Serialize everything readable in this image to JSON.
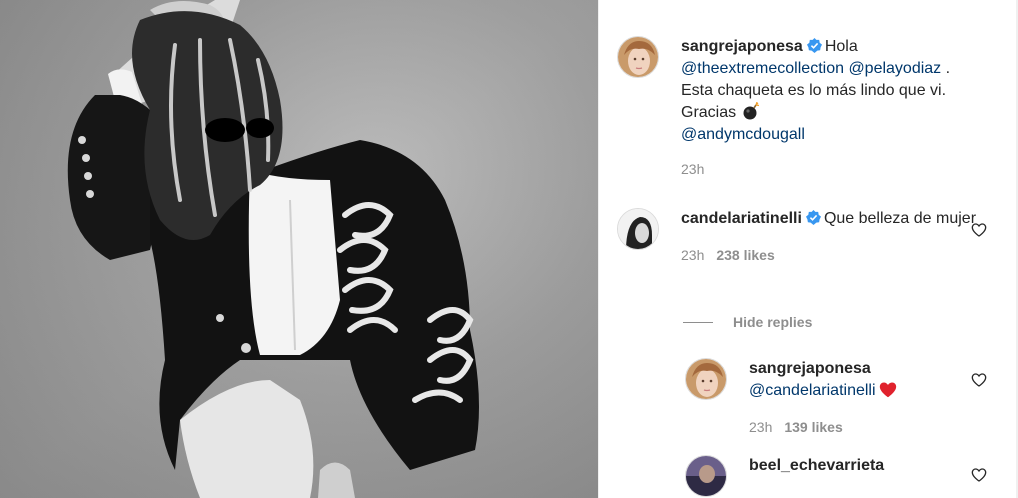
{
  "post": {
    "image_alt": "Black and white photo of a woman in a black jacket with white braided embroidery"
  },
  "caption": {
    "username": "sangrejaponesa",
    "verified": true,
    "text_hola": "Hola",
    "mention_1": "@theextremecollection",
    "mention_2": "@pelayodiaz",
    "text_dot": ".",
    "text_line2": "Esta chaqueta es lo más lindo que vi.",
    "text_line3": "Gracias",
    "emoji_icon": "bomb-icon",
    "mention_3": "@andymcdougall",
    "time": "23h"
  },
  "comments": [
    {
      "username": "candelariatinelli",
      "verified": true,
      "text": "Que belleza de mujer",
      "time": "23h",
      "likes": "238 likes"
    }
  ],
  "replies_toggle": "Hide replies",
  "replies": [
    {
      "username": "sangrejaponesa",
      "mention": "@candelariatinelli",
      "emoji_icon": "red-heart-icon",
      "time": "23h",
      "likes": "139 likes"
    },
    {
      "username": "beel_echevarrieta"
    }
  ],
  "colors": {
    "link": "#00376b",
    "muted": "#8e8e8e",
    "verified": "#3897f0",
    "heart_red": "#ed4956"
  }
}
